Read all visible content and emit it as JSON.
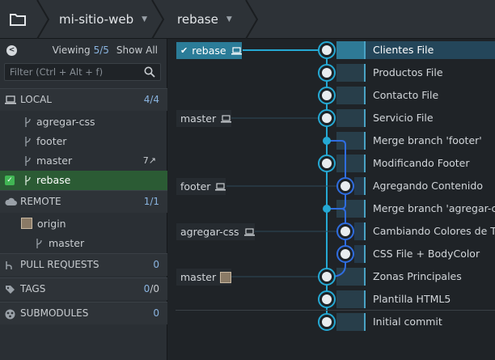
{
  "topbar": {
    "repo_name": "mi-sitio-web",
    "branch_name": "rebase"
  },
  "sidebar": {
    "viewing_label": "Viewing",
    "viewing_count": "5/5",
    "show_all_label": "Show All",
    "filter_placeholder": "Filter (Ctrl + Alt + f)",
    "local": {
      "label": "LOCAL",
      "count": "4/4",
      "branches": [
        {
          "name": "agregar-css"
        },
        {
          "name": "footer"
        },
        {
          "name": "master",
          "tail": "7↗"
        },
        {
          "name": "rebase",
          "active": true
        }
      ]
    },
    "remote": {
      "label": "REMOTE",
      "count": "1/1",
      "origin": "origin",
      "branches": [
        {
          "name": "master"
        }
      ]
    },
    "pull_requests": {
      "label": "PULL REQUESTS",
      "count": "0"
    },
    "tags": {
      "label": "TAGS",
      "count_a": "0",
      "count_b": "/0"
    },
    "submodules": {
      "label": "SUBMODULES",
      "count": "0"
    }
  },
  "graph": {
    "refs": [
      {
        "label": "rebase",
        "head": true
      },
      {
        "label": "master"
      },
      {
        "label": "footer"
      },
      {
        "label": "agregar-css"
      },
      {
        "label": "master",
        "remote_avatar": true
      }
    ],
    "commits": [
      {
        "message": "Clientes File",
        "selected": true
      },
      {
        "message": "Productos File"
      },
      {
        "message": "Contacto File"
      },
      {
        "message": "Servicio File"
      },
      {
        "message": "Merge branch 'footer'"
      },
      {
        "message": "Modificando Footer"
      },
      {
        "message": "Agregando Contenido"
      },
      {
        "message": "Merge branch 'agregar-css'"
      },
      {
        "message": "Cambiando Colores de Texto"
      },
      {
        "message": "CSS File + BodyColor"
      },
      {
        "message": "Zonas Principales"
      },
      {
        "message": "Plantilla HTML5"
      },
      {
        "message": "Initial commit"
      }
    ]
  },
  "colors": {
    "lane_main": "#25a9d4",
    "lane_branch": "#2f6de0",
    "active_branch": "#2b5b34",
    "head_ref": "#2b7c98"
  }
}
